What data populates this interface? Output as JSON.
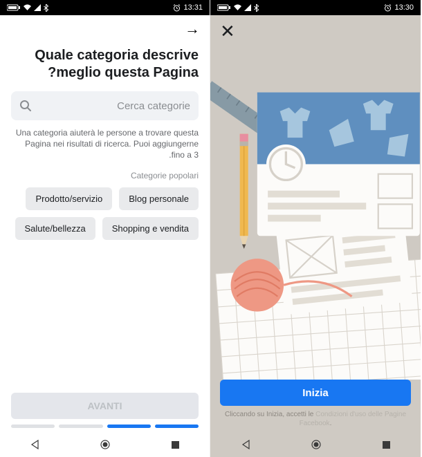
{
  "status": {
    "time_left": "13:31",
    "time_right": "13:30"
  },
  "left_screen": {
    "heading": "Quale categoria descrive meglio questa Pagina?",
    "search_placeholder": "Cerca categorie",
    "helper_text": "Una categoria aiuterà le persone a trovare questa Pagina nei risultati di ricerca. Puoi aggiungerne fino a 3.",
    "popular_label": "Categorie popolari",
    "chips": [
      "Blog personale",
      "Prodotto/servizio",
      "Shopping e vendita",
      "Salute/bellezza"
    ],
    "next_button": "AVANTI"
  },
  "right_screen": {
    "start_button": "Inizia",
    "terms_prefix": "Cliccando su Inizia, accetti le ",
    "terms_link": "Condizioni d'uso delle Pagine Facebook",
    "terms_suffix": "."
  }
}
